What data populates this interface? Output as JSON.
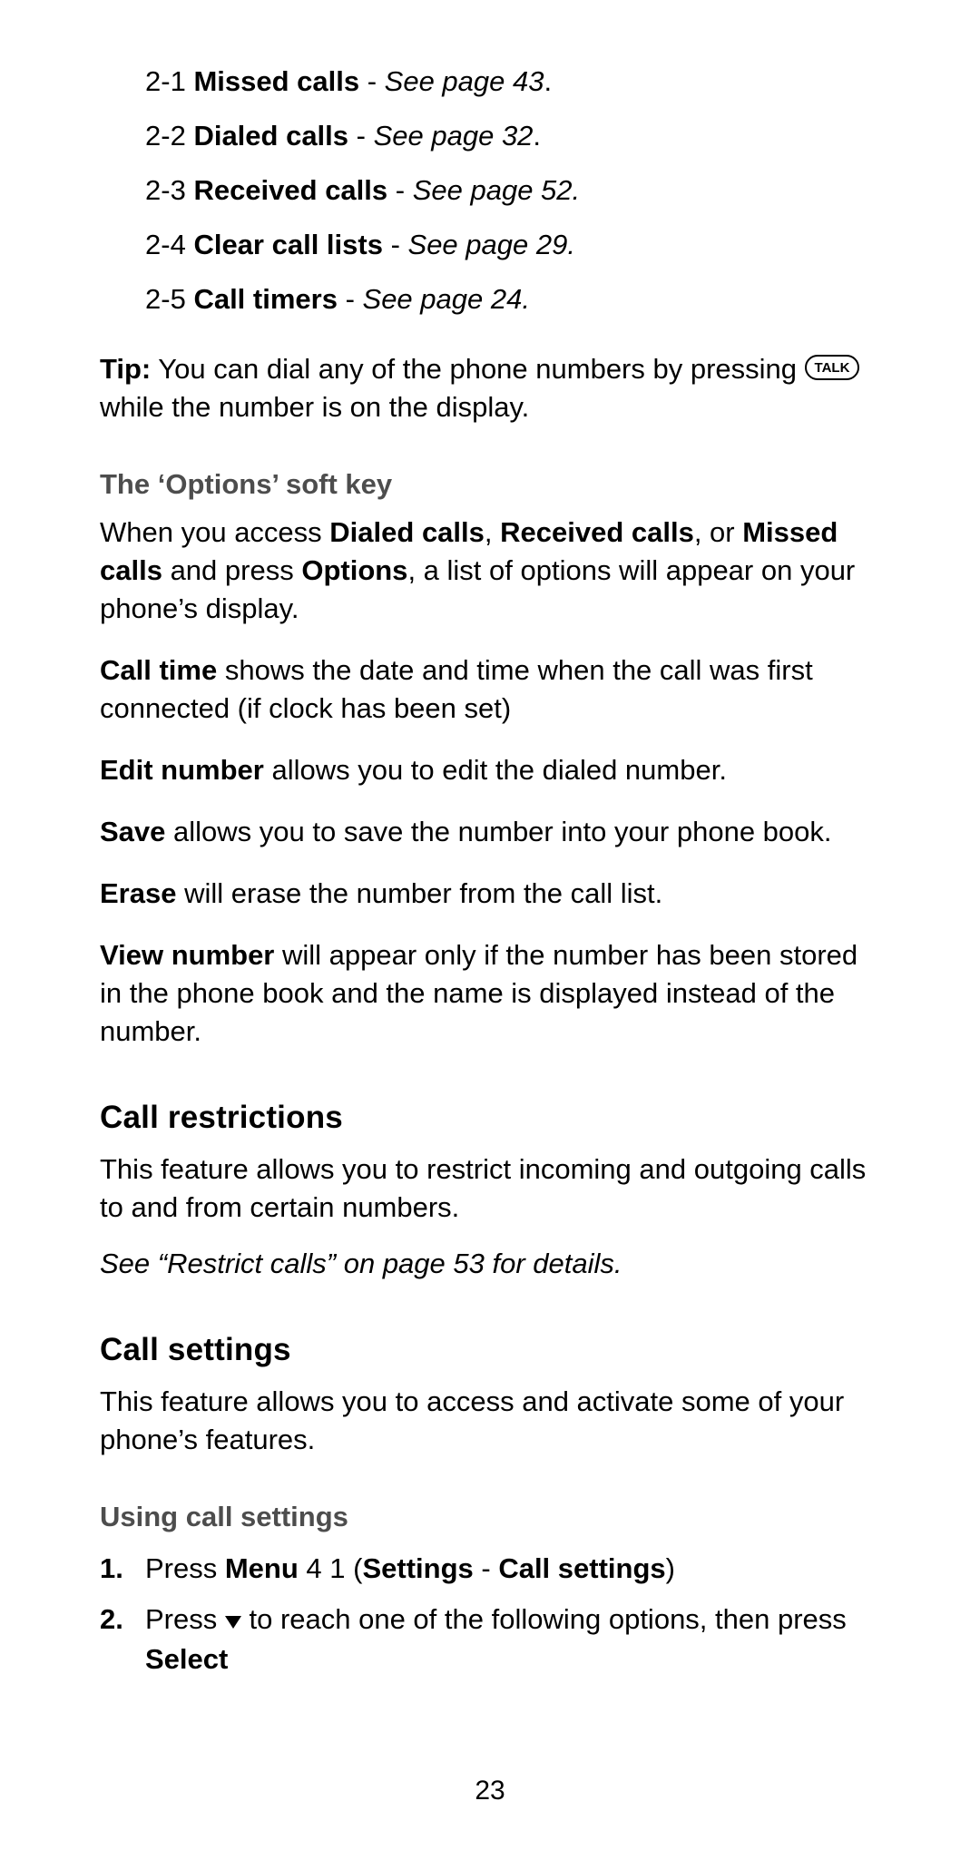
{
  "menu_items": [
    {
      "num": "2-1",
      "title": "Missed calls",
      "ref": "See page 43",
      "trailing": "."
    },
    {
      "num": "2-2",
      "title": "Dialed calls",
      "ref": "See page 32",
      "trailing": "."
    },
    {
      "num": "2-3",
      "title": "Received calls",
      "ref": "See page 52.",
      "trailing": ""
    },
    {
      "num": "2-4",
      "title": "Clear call lists",
      "ref": "See page 29.",
      "trailing": ""
    },
    {
      "num": "2-5",
      "title": "Call timers",
      "ref": "See page 24.",
      "trailing": ""
    }
  ],
  "tip": {
    "label": "Tip:",
    "text_before_key": " You can dial any of the phone numbers by pressing ",
    "key_label": "TALK",
    "text_after_key": " while the number is on the display."
  },
  "options_softkey": {
    "heading": "The ‘Options’ soft key",
    "intro_prefix": "When you access ",
    "intro_bold1": "Dialed calls",
    "intro_sep1": ", ",
    "intro_bold2": "Received calls",
    "intro_sep2": ", or ",
    "intro_bold3": "Missed calls",
    "intro_mid": " and press ",
    "intro_bold4": "Options",
    "intro_suffix": ", a list of options will appear on your phone’s display.",
    "items": [
      {
        "bold": "Call time",
        "rest": " shows the date and time when the call was first connected (if clock has been set)"
      },
      {
        "bold": "Edit number",
        "rest": " allows you to edit the dialed number."
      },
      {
        "bold": "Save",
        "rest": " allows you to save the number into your phone book."
      },
      {
        "bold": "Erase",
        "rest": " will erase the number from the call list."
      },
      {
        "bold": "View number",
        "rest": " will appear only if the number has been stored in the phone book and the name is displayed instead of the number."
      }
    ]
  },
  "call_restrictions": {
    "heading": "Call restrictions",
    "body": "This feature allows you to restrict incoming and outgoing calls to and from certain numbers.",
    "ref": "See “Restrict calls” on page 53 for details."
  },
  "call_settings": {
    "heading": "Call settings",
    "body": "This feature allows you to access and activate some of your phone’s features.",
    "sub_heading": "Using call settings",
    "steps": [
      {
        "num": "1.",
        "segments": [
          {
            "t": "Press ",
            "b": false
          },
          {
            "t": "Menu",
            "b": true
          },
          {
            "t": " 4 1 (",
            "b": false
          },
          {
            "t": "Settings",
            "b": true
          },
          {
            "t": " - ",
            "b": false
          },
          {
            "t": "Call settings",
            "b": true
          },
          {
            "t": ")",
            "b": false
          }
        ]
      },
      {
        "num": "2.",
        "pre_icon": "Press ",
        "icon": "down-triangle",
        "post_icon_segments": [
          {
            "t": " to reach one of the following options, then press ",
            "b": false
          },
          {
            "t": "Select",
            "b": true
          }
        ]
      }
    ]
  },
  "page_number": "23"
}
